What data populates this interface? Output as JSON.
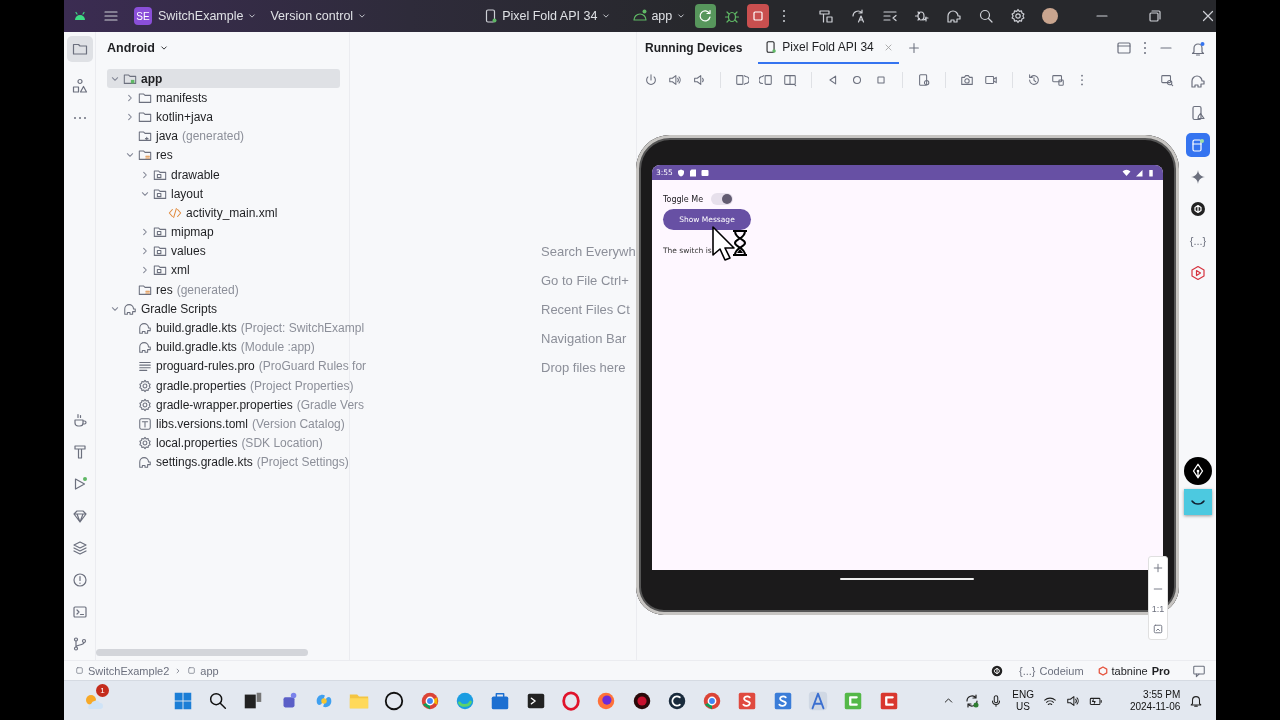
{
  "title_bar": {
    "project_badge": "SE",
    "project": "SwitchExample",
    "vcs": "Version control",
    "device": "Pixel Fold API 34",
    "run_config": "app"
  },
  "project_panel": {
    "view": "Android",
    "tree": [
      {
        "label": "app",
        "kind": "module",
        "expanded": true,
        "selected": true,
        "children": [
          {
            "label": "manifests",
            "kind": "folder",
            "expanded": false,
            "selected": false
          },
          {
            "label": "kotlin+java",
            "kind": "folder",
            "expanded": false,
            "selected": false
          },
          {
            "label": "java",
            "note": "(generated)",
            "kind": "generated_folder",
            "selected": false
          },
          {
            "label": "res",
            "kind": "resource_folder",
            "expanded": true,
            "selected": false,
            "children": [
              {
                "label": "drawable",
                "kind": "package",
                "expanded": false,
                "selected": false
              },
              {
                "label": "layout",
                "kind": "package",
                "expanded": true,
                "selected": false,
                "children": [
                  {
                    "label": "activity_main.xml",
                    "kind": "xml",
                    "selected": false
                  }
                ]
              },
              {
                "label": "mipmap",
                "kind": "package",
                "expanded": false,
                "selected": false
              },
              {
                "label": "values",
                "kind": "package",
                "expanded": false,
                "selected": false
              },
              {
                "label": "xml",
                "kind": "package",
                "expanded": false,
                "selected": false
              }
            ]
          },
          {
            "label": "res",
            "note": "(generated)",
            "kind": "resource_folder",
            "selected": false
          }
        ]
      },
      {
        "label": "Gradle Scripts",
        "kind": "gradle",
        "expanded": true,
        "selected": false,
        "children": [
          {
            "label": "build.gradle.kts",
            "note": "(Project: SwitchExampl",
            "kind": "gradle_file",
            "selected": false
          },
          {
            "label": "build.gradle.kts",
            "note": "(Module :app)",
            "kind": "gradle_file",
            "selected": false
          },
          {
            "label": "proguard-rules.pro",
            "note": "(ProGuard Rules for",
            "kind": "text",
            "selected": false
          },
          {
            "label": "gradle.properties",
            "note": "(Project Properties)",
            "kind": "properties",
            "selected": false
          },
          {
            "label": "gradle-wrapper.properties",
            "note": "(Gradle Vers",
            "kind": "properties",
            "selected": false
          },
          {
            "label": "libs.versions.toml",
            "note": "(Version Catalog)",
            "kind": "toml",
            "selected": false
          },
          {
            "label": "local.properties",
            "note": "(SDK Location)",
            "kind": "properties",
            "selected": false
          },
          {
            "label": "settings.gradle.kts",
            "note": "(Project Settings)",
            "kind": "gradle_file",
            "selected": false
          }
        ]
      }
    ]
  },
  "editor_hints": [
    "Search Everywh",
    "Go to File Ctrl+",
    "Recent Files Ct",
    "Navigation Bar",
    "Drop files here"
  ],
  "running_devices": {
    "title": "Running Devices",
    "tabs": [
      {
        "label": "Pixel Fold API 34",
        "selected": true
      }
    ],
    "zoom_reset": "1:1"
  },
  "device": {
    "status_time": "3:55",
    "switch": {
      "label": "Toggle Me",
      "on": true
    },
    "button": "Show Message",
    "message": "The switch is"
  },
  "right_toolbar": {
    "codeium_glyph": "{...}"
  },
  "status_bar": {
    "breadcrumbs": [
      "SwitchExample2",
      "app"
    ],
    "codeium_glyph": "{...}",
    "codeium": "Codeium",
    "tabnine": "tabnine",
    "tabnine_plan": "Pro"
  },
  "taskbar": {
    "notification_badge": "1",
    "language": "ENG",
    "region": "US",
    "time": "3:55 PM",
    "date": "2024-11-06"
  }
}
